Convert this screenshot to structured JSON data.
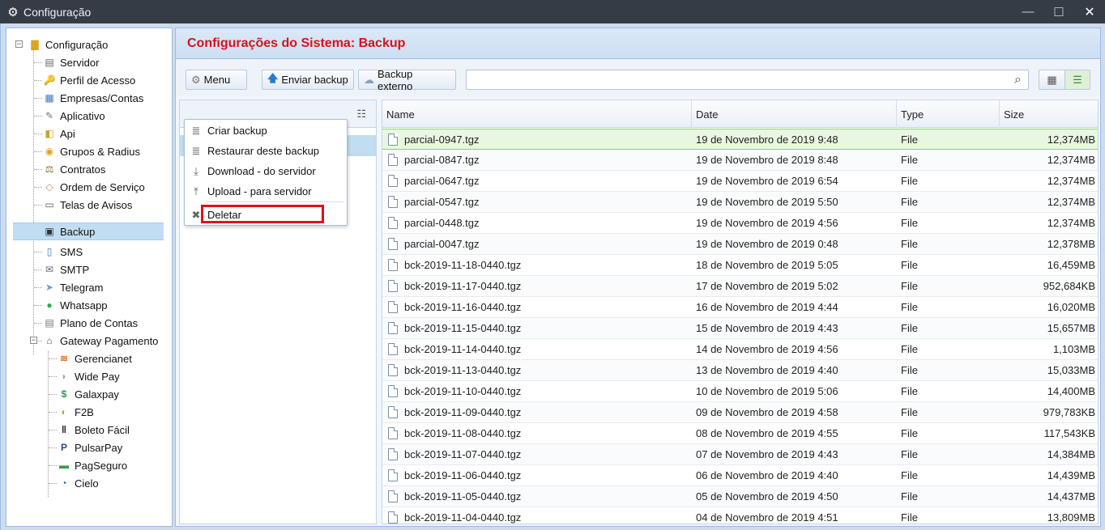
{
  "window": {
    "title": "Configuração",
    "minimize": "—",
    "maximize": "☐",
    "close": "✕"
  },
  "sidebar": {
    "root": "Configuração",
    "items": [
      {
        "label": "Servidor",
        "icon": "server-icon"
      },
      {
        "label": "Perfil de Acesso",
        "icon": "access-profile-icon"
      },
      {
        "label": "Empresas/Contas",
        "icon": "companies-icon"
      },
      {
        "label": "Aplicativo",
        "icon": "app-icon"
      },
      {
        "label": "Api",
        "icon": "api-icon"
      },
      {
        "label": "Grupos & Radius",
        "icon": "groups-icon"
      },
      {
        "label": "Contratos",
        "icon": "contracts-icon"
      },
      {
        "label": "Ordem de Serviço",
        "icon": "service-order-icon"
      },
      {
        "label": "Telas de Avisos",
        "icon": "notice-screens-icon"
      },
      {
        "label": "Backup",
        "icon": "backup-icon"
      },
      {
        "label": "SMS",
        "icon": "sms-icon"
      },
      {
        "label": "SMTP",
        "icon": "smtp-icon"
      },
      {
        "label": "Telegram",
        "icon": "telegram-icon"
      },
      {
        "label": "Whatsapp",
        "icon": "whatsapp-icon"
      },
      {
        "label": "Plano de Contas",
        "icon": "chart-of-accounts-icon"
      },
      {
        "label": "Gateway Pagamento",
        "icon": "payment-gateway-icon"
      }
    ],
    "gateway_items": [
      {
        "label": "Gerencianet",
        "icon": "gerencianet-icon"
      },
      {
        "label": "Wide Pay",
        "icon": "widepay-icon"
      },
      {
        "label": "Galaxpay",
        "icon": "galaxpay-icon"
      },
      {
        "label": "F2B",
        "icon": "f2b-icon"
      },
      {
        "label": "Boleto Fácil",
        "icon": "barcode-icon"
      },
      {
        "label": "PulsarPay",
        "icon": "pulsarpay-icon"
      },
      {
        "label": "PagSeguro",
        "icon": "pagseguro-icon"
      },
      {
        "label": "Cielo",
        "icon": "cielo-icon"
      }
    ]
  },
  "main": {
    "title": "Configurações do Sistema: Backup",
    "toolbar": {
      "menu_label": "Menu",
      "send_label": "Enviar backup",
      "external_label": "Backup externo",
      "search_value": ""
    },
    "menu": {
      "items": [
        {
          "label": "Criar backup",
          "icon": "database-icon"
        },
        {
          "label": "Restaurar deste backup",
          "icon": "database-restore-icon"
        },
        {
          "label": "Download - do servidor",
          "icon": "download-icon"
        },
        {
          "label": "Upload - para servidor",
          "icon": "upload-icon"
        },
        {
          "label": "Deletar",
          "icon": "delete-icon"
        }
      ]
    },
    "grid": {
      "columns": [
        "Name",
        "Date",
        "Type",
        "Size"
      ],
      "rows": [
        {
          "name": "parcial-0947.tgz",
          "date": "19 de Novembro de 2019 9:48",
          "type": "File",
          "size": "12,374MB"
        },
        {
          "name": "parcial-0847.tgz",
          "date": "19 de Novembro de 2019 8:48",
          "type": "File",
          "size": "12,374MB"
        },
        {
          "name": "parcial-0647.tgz",
          "date": "19 de Novembro de 2019 6:54",
          "type": "File",
          "size": "12,374MB"
        },
        {
          "name": "parcial-0547.tgz",
          "date": "19 de Novembro de 2019 5:50",
          "type": "File",
          "size": "12,374MB"
        },
        {
          "name": "parcial-0448.tgz",
          "date": "19 de Novembro de 2019 4:56",
          "type": "File",
          "size": "12,374MB"
        },
        {
          "name": "parcial-0047.tgz",
          "date": "19 de Novembro de 2019 0:48",
          "type": "File",
          "size": "12,378MB"
        },
        {
          "name": "bck-2019-11-18-0440.tgz",
          "date": "18 de Novembro de 2019 5:05",
          "type": "File",
          "size": "16,459MB"
        },
        {
          "name": "bck-2019-11-17-0440.tgz",
          "date": "17 de Novembro de 2019 5:02",
          "type": "File",
          "size": "952,684KB"
        },
        {
          "name": "bck-2019-11-16-0440.tgz",
          "date": "16 de Novembro de 2019 4:44",
          "type": "File",
          "size": "16,020MB"
        },
        {
          "name": "bck-2019-11-15-0440.tgz",
          "date": "15 de Novembro de 2019 4:43",
          "type": "File",
          "size": "15,657MB"
        },
        {
          "name": "bck-2019-11-14-0440.tgz",
          "date": "14 de Novembro de 2019 4:56",
          "type": "File",
          "size": "1,103MB"
        },
        {
          "name": "bck-2019-11-13-0440.tgz",
          "date": "13 de Novembro de 2019 4:40",
          "type": "File",
          "size": "15,033MB"
        },
        {
          "name": "bck-2019-11-10-0440.tgz",
          "date": "10 de Novembro de 2019 5:06",
          "type": "File",
          "size": "14,400MB"
        },
        {
          "name": "bck-2019-11-09-0440.tgz",
          "date": "09 de Novembro de 2019 4:58",
          "type": "File",
          "size": "979,783KB"
        },
        {
          "name": "bck-2019-11-08-0440.tgz",
          "date": "08 de Novembro de 2019 4:55",
          "type": "File",
          "size": "117,543KB"
        },
        {
          "name": "bck-2019-11-07-0440.tgz",
          "date": "07 de Novembro de 2019 4:43",
          "type": "File",
          "size": "14,384MB"
        },
        {
          "name": "bck-2019-11-06-0440.tgz",
          "date": "06 de Novembro de 2019 4:40",
          "type": "File",
          "size": "14,439MB"
        },
        {
          "name": "bck-2019-11-05-0440.tgz",
          "date": "05 de Novembro de 2019 4:50",
          "type": "File",
          "size": "14,437MB"
        },
        {
          "name": "bck-2019-11-04-0440.tgz",
          "date": "04 de Novembro de 2019 4:51",
          "type": "File",
          "size": "13,809MB"
        }
      ]
    }
  },
  "colors": {
    "title_red": "#d8121b",
    "highlight_red": "#e0101e",
    "selected_green": "#e8f7e1",
    "tree_selected": "#c1ddf1"
  }
}
